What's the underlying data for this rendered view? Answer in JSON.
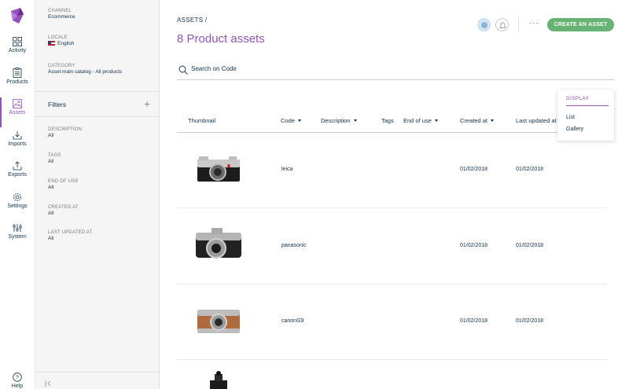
{
  "nav": {
    "items": [
      {
        "id": "activity",
        "label": "Activity",
        "icon": "grid-icon"
      },
      {
        "id": "products",
        "label": "Products",
        "icon": "clipboard-icon"
      },
      {
        "id": "assets",
        "label": "Assets",
        "icon": "image-icon",
        "active": true
      },
      {
        "id": "imports",
        "label": "Imports",
        "icon": "import-icon"
      },
      {
        "id": "exports",
        "label": "Exports",
        "icon": "export-icon"
      },
      {
        "id": "settings",
        "label": "Settings",
        "icon": "gear-icon"
      },
      {
        "id": "system",
        "label": "System",
        "icon": "sliders-icon"
      }
    ],
    "help_label": "Help"
  },
  "context": {
    "channel_label": "CHANNEL",
    "channel_value": "Ecommerce",
    "locale_label": "LOCALE",
    "locale_value": "English",
    "category_label": "CATEGORY",
    "category_value": "Asset main catalog - All products"
  },
  "filters": {
    "title": "Filters",
    "items": [
      {
        "label": "DESCRIPTION",
        "value": "All"
      },
      {
        "label": "TAGS",
        "value": "All"
      },
      {
        "label": "END OF USE",
        "value": "All"
      },
      {
        "label": "CREATED AT",
        "value": "All"
      },
      {
        "label": "LAST UPDATED AT",
        "value": "All"
      }
    ]
  },
  "header": {
    "breadcrumb": "ASSETS /",
    "title": "8 Product assets",
    "create_label": "CREATE AN ASSET",
    "more_label": "···"
  },
  "search": {
    "placeholder": "Search on Code"
  },
  "table": {
    "columns": {
      "thumbnail": "Thumbnail",
      "code": "Code",
      "description": "Description",
      "tags": "Tags",
      "end_of_use": "End of use",
      "created_at": "Created at",
      "last_updated_at": "Last updated at"
    },
    "rows": [
      {
        "code": "leica",
        "created_at": "01/02/2018",
        "last_updated_at": "01/02/2018"
      },
      {
        "code": "panasonic",
        "created_at": "01/02/2018",
        "last_updated_at": "01/02/2018"
      },
      {
        "code": "canonG9",
        "created_at": "01/02/2018",
        "last_updated_at": "01/02/2018"
      }
    ]
  },
  "display": {
    "title": "DISPLAY",
    "options": [
      "List",
      "Gallery"
    ]
  },
  "colors": {
    "accent": "#9452ba",
    "primary_button": "#67b373",
    "text": "#11324d"
  }
}
